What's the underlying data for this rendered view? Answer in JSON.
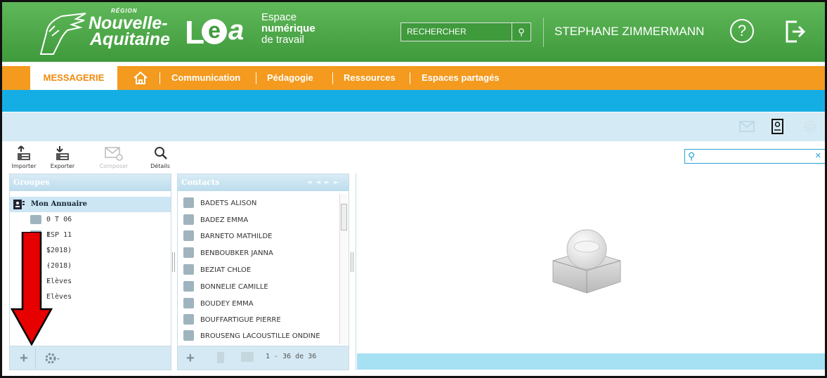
{
  "header": {
    "region_small": "RÉGION",
    "region_line1": "Nouvelle-",
    "region_line2": "Aquitaine",
    "lea_logo": "Lea",
    "espace_line1": "Espace",
    "espace_line2": "numérique",
    "espace_line3": "de travail",
    "search_label": "RECHERCHER",
    "username": "STEPHANE ZIMMERMANN",
    "help_icon": "question-icon",
    "logout_icon": "logout-icon"
  },
  "nav": {
    "active_tab": "MESSAGERIE",
    "home_icon": "home-icon",
    "items": [
      "Communication",
      "Pédagogie",
      "Ressources",
      "Espaces partagés"
    ]
  },
  "toolbar": {
    "import_label": "Importer",
    "export_label": "Exporter",
    "compose_label": "Composer",
    "details_label": "Détails"
  },
  "groups": {
    "title": "Groupes",
    "items": [
      {
        "label": "Mon Annuaire"
      },
      {
        "label": "0 T 06 ES (2018) - Elèves"
      },
      {
        "label": "1 P 11 S (2018) - Elèves"
      }
    ]
  },
  "contacts": {
    "title": "Contacts",
    "items": [
      "BADETS ALISON",
      "BADEZ EMMA",
      "BARNETO MATHILDE",
      "BENBOUBKER JANNA",
      "BEZIAT CHLOE",
      "BONNELIE CAMILLE",
      "BOUDEY EMMA",
      "BOUFFARTIGUE PIERRE",
      "BROUSENG LACOUSTILLE ONDINE"
    ],
    "pagination": "1 - 36 de 36"
  },
  "colors": {
    "header_green": "#4aa846",
    "nav_orange": "#f39a1f",
    "blue_bar": "#15aee4",
    "arrow_red": "#e60000"
  }
}
